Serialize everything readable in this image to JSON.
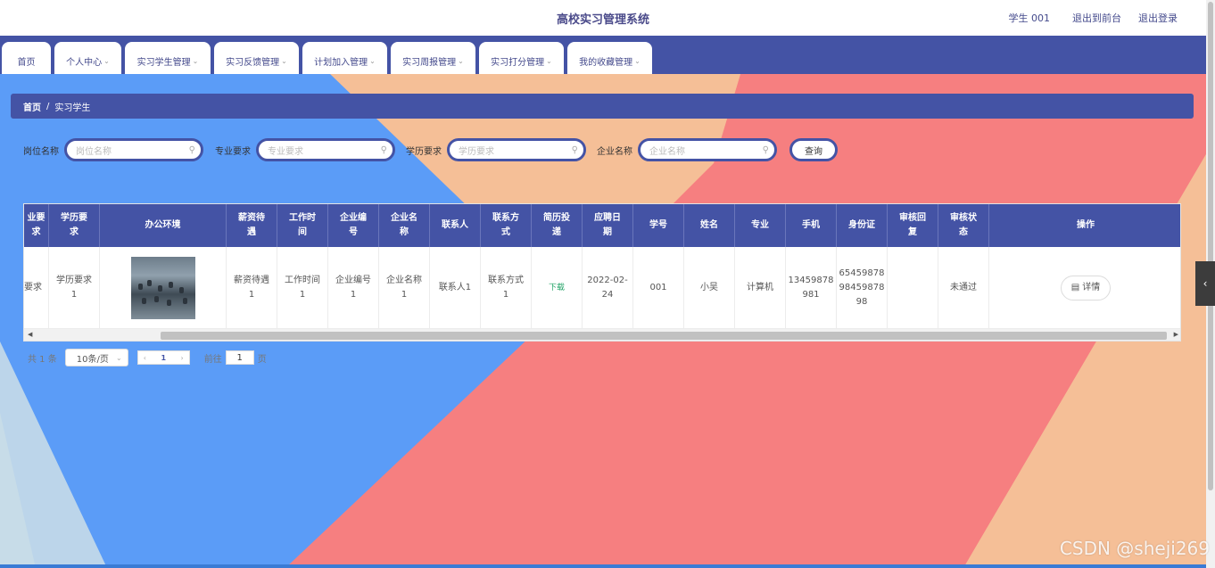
{
  "header": {
    "title": "高校实习管理系统",
    "user": "学生 001",
    "back_front": "退出到前台",
    "logout": "退出登录"
  },
  "nav": {
    "tabs": [
      {
        "label": "首页",
        "has_dropdown": false
      },
      {
        "label": "个人中心",
        "has_dropdown": true
      },
      {
        "label": "实习学生管理",
        "has_dropdown": true
      },
      {
        "label": "实习反馈管理",
        "has_dropdown": true
      },
      {
        "label": "计划加入管理",
        "has_dropdown": true
      },
      {
        "label": "实习周报管理",
        "has_dropdown": true
      },
      {
        "label": "实习打分管理",
        "has_dropdown": true
      },
      {
        "label": "我的收藏管理",
        "has_dropdown": true
      }
    ]
  },
  "breadcrumb": {
    "home": "首页",
    "sep": "/",
    "current": "实习学生"
  },
  "search": {
    "fields": [
      {
        "label": "岗位名称",
        "placeholder": "岗位名称"
      },
      {
        "label": "专业要求",
        "placeholder": "专业要求"
      },
      {
        "label": "学历要求",
        "placeholder": "学历要求"
      },
      {
        "label": "企业名称",
        "placeholder": "企业名称"
      }
    ],
    "button": "查询"
  },
  "table": {
    "headers": [
      "专业要求",
      "学历要求",
      "办公环境",
      "薪资待遇",
      "工作时间",
      "企业编号",
      "企业名称",
      "联系人",
      "联系方式",
      "简历投递",
      "应聘日期",
      "学号",
      "姓名",
      "专业",
      "手机",
      "身份证",
      "审核回复",
      "审核状态",
      "操作"
    ],
    "header_display": [
      "业要\n求",
      "学历要\n求",
      "办公环境",
      "薪资待\n遇",
      "工作时\n间",
      "企业编\n号",
      "企业名\n称",
      "联系人",
      "联系方\n式",
      "简历投\n递",
      "应聘日\n期",
      "学号",
      "姓名",
      "专业",
      "手机",
      "身份证",
      "审核回\n复",
      "审核状\n态",
      "操作"
    ],
    "row": {
      "major_req": "要求",
      "edu_req": "学历要求\n1",
      "salary": "薪资待遇\n1",
      "work_time": "工作时间\n1",
      "company_no": "企业编号\n1",
      "company_name": "企业名称\n1",
      "contact": "联系人1",
      "contact_method": "联系方式\n1",
      "resume": "下载",
      "date": "2022-02-\n24",
      "student_no": "001",
      "name": "小吴",
      "major": "计算机",
      "phone": "13459878\n981",
      "id_card": "65459878\n98459878\n98",
      "review_reply": "",
      "review_status": "未通过",
      "action": "详情"
    }
  },
  "pagination": {
    "total": "共 1 条",
    "page_size": "10条/页",
    "current_page": "1",
    "goto_label": "前往",
    "goto_value": "1",
    "page_unit": "页"
  },
  "watermark": "CSDN @sheji269",
  "colors": {
    "primary": "#4453a5",
    "bg_blue": "#5b9cf7",
    "bg_red": "#f67f80",
    "bg_peach": "#f5bf97",
    "bg_lightblue": "#c6dbe8"
  }
}
